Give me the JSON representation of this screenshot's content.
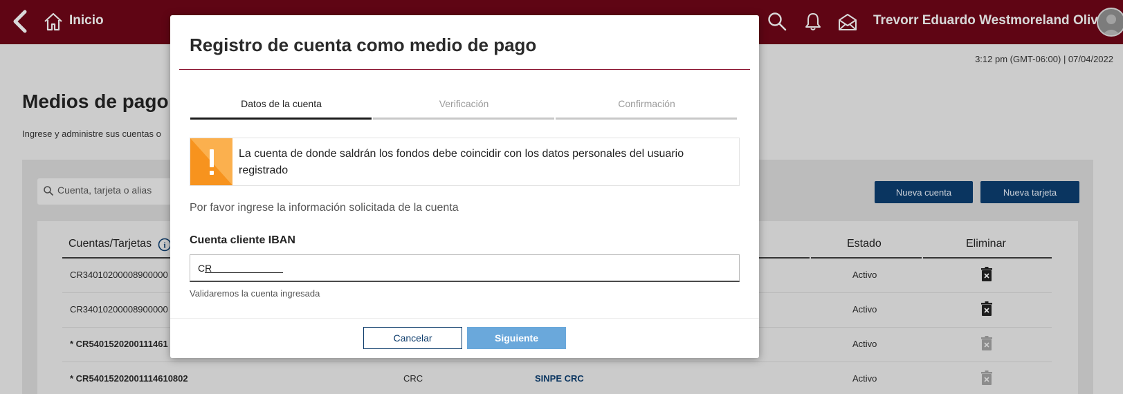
{
  "topbar": {
    "home_label": "Inicio",
    "user_name": "Trevorr Eduardo Westmoreland Olivier"
  },
  "page": {
    "timestamp": "3:12 pm (GMT-06:00) | 07/04/2022",
    "title": "Medios de pago",
    "subtitle": "Ingrese y administre sus cuentas o",
    "search_placeholder": "Cuenta, tarjeta o alias",
    "new_account_label": "Nueva cuenta",
    "new_card_label": "Nueva tarjeta"
  },
  "table": {
    "headers": {
      "accounts": "Cuentas/Tarjetas",
      "status": "Estado",
      "delete": "Eliminar"
    },
    "rows": [
      {
        "account": "CR34010200008900000",
        "currency": "",
        "type": "",
        "status": "Activo"
      },
      {
        "account": "CR34010200008900000",
        "currency": "",
        "type": "",
        "status": "Activo"
      },
      {
        "account": "* CR5401520200111461",
        "currency": "",
        "type": "",
        "status": "Activo"
      },
      {
        "account": "* CR54015202001114610802",
        "currency": "CRC",
        "type": "SINPE CRC",
        "status": "Activo"
      }
    ]
  },
  "modal": {
    "title": "Registro de cuenta como medio de pago",
    "steps": [
      {
        "label": "Datos de la cuenta"
      },
      {
        "label": "Verificación"
      },
      {
        "label": "Confirmación"
      }
    ],
    "alert_text": "La cuenta de donde saldrán los fondos debe coincidir con los datos personales del usuario registrado",
    "instructions": "Por favor ingrese la información solicitada de la cuenta",
    "field_label": "Cuenta cliente IBAN",
    "iban_value": "CR",
    "help_text": "Validaremos la cuenta ingresada",
    "cancel_label": "Cancelar",
    "next_label": "Siguiente"
  },
  "colors": {
    "topbar": "#6a0617",
    "primary_button": "#0c3b6b",
    "next_button": "#6aa8db",
    "alert_orange": "#f7931e"
  }
}
